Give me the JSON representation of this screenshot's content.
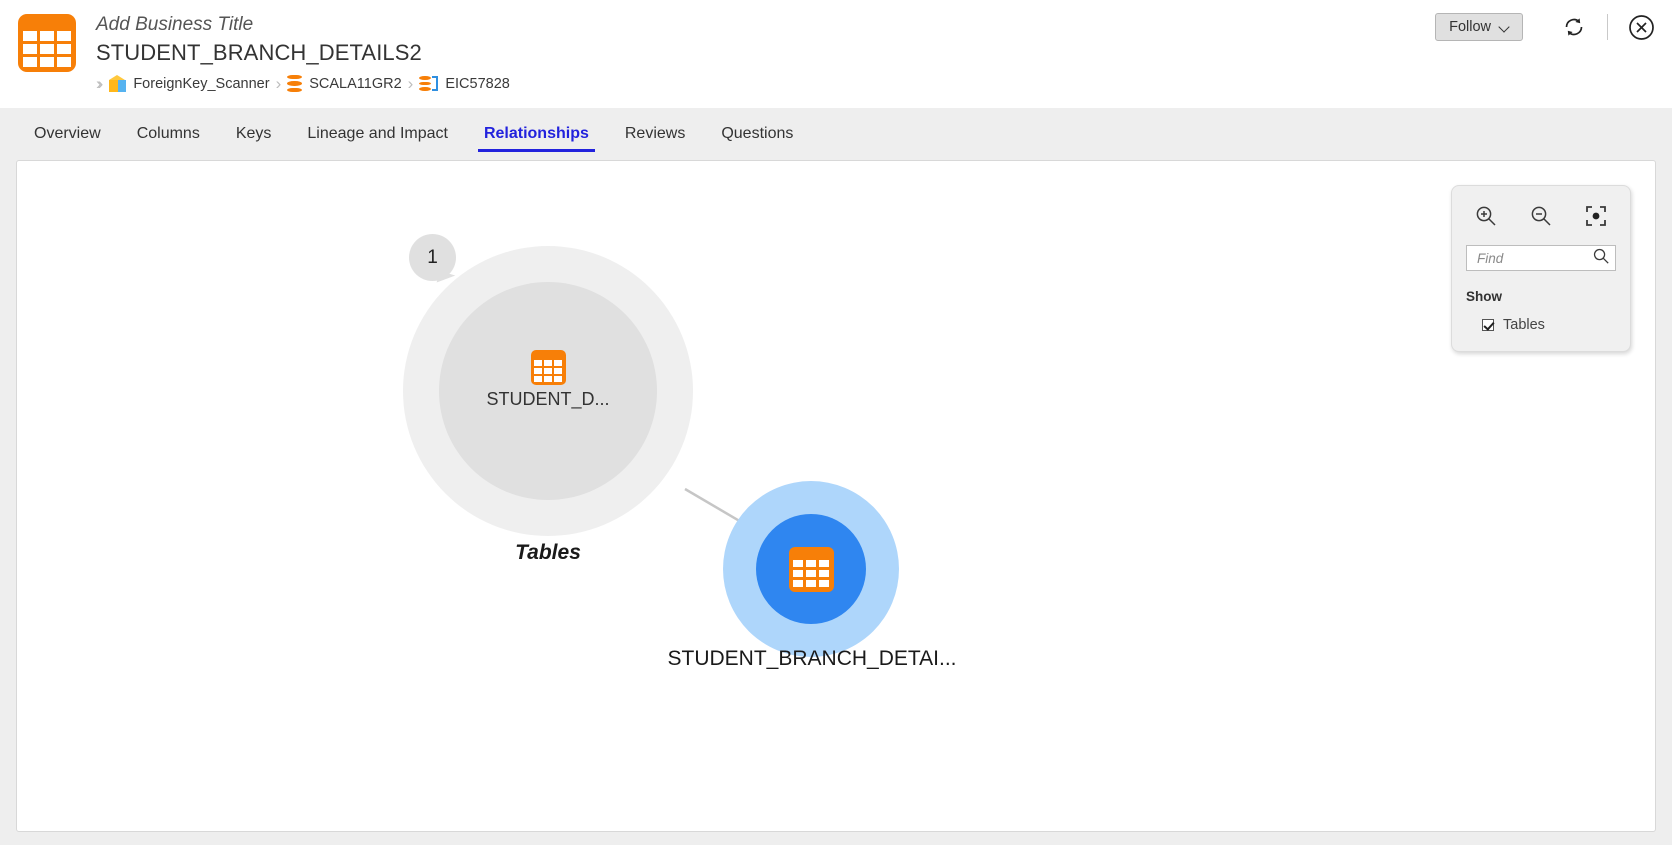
{
  "header": {
    "business_title": "Add Business Title",
    "object_title": "STUDENT_BRANCH_DETAILS2",
    "object_icon": "table-icon",
    "breadcrumb": [
      {
        "label": "ForeignKey_Scanner",
        "icon": "cube-icon"
      },
      {
        "label": "SCALA11GR2",
        "icon": "database-icon"
      },
      {
        "label": "EIC57828",
        "icon": "database-column-icon"
      }
    ],
    "follow_button": "Follow",
    "follow_caret_icon": "chevron-down-icon",
    "refresh_icon": "refresh-icon",
    "close_icon": "close-circle-icon"
  },
  "tabs": [
    {
      "label": "Overview",
      "active": false
    },
    {
      "label": "Columns",
      "active": false
    },
    {
      "label": "Keys",
      "active": false
    },
    {
      "label": "Lineage and Impact",
      "active": false
    },
    {
      "label": "Relationships",
      "active": true
    },
    {
      "label": "Reviews",
      "active": false
    },
    {
      "label": "Questions",
      "active": false
    }
  ],
  "graph": {
    "group_node": {
      "badge_count": "1",
      "inner_label": "STUDENT_D...",
      "caption": "Tables",
      "icon": "table-icon"
    },
    "table_node": {
      "label": "STUDENT_BRANCH_DETAI...",
      "icon": "table-icon"
    }
  },
  "controls": {
    "zoom_in_icon": "zoom-in-icon",
    "zoom_out_icon": "zoom-out-icon",
    "fit_icon": "fit-to-screen-icon",
    "find_placeholder": "Find",
    "find_value": "",
    "search_icon": "search-icon",
    "show_title": "Show",
    "show_items": [
      {
        "label": "Tables",
        "checked": true
      }
    ]
  },
  "colors": {
    "accent_orange": "#f77f08",
    "tab_active": "#2222dd",
    "node_blue": "#2f86f0",
    "node_halo": "#aed6fb",
    "group_outer": "#efefef",
    "group_inner": "#e0e0e0",
    "page_bg": "#eeeeee"
  }
}
